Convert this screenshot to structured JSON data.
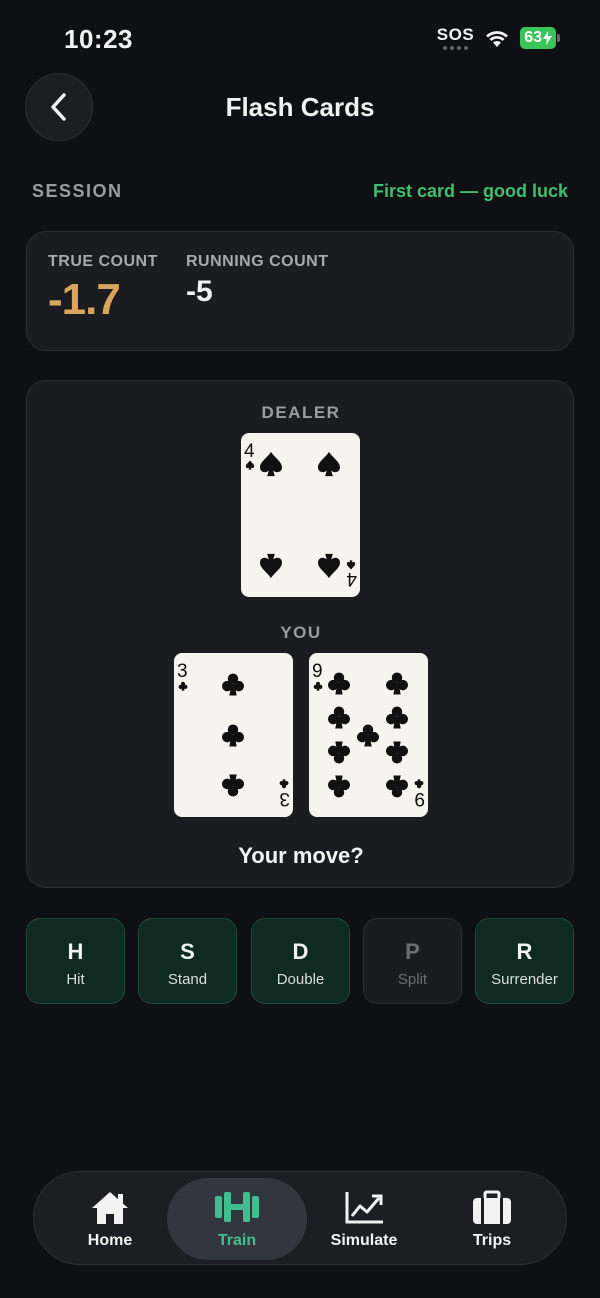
{
  "status_bar": {
    "time": "10:23",
    "sos": "SOS",
    "battery": "63"
  },
  "header": {
    "title": "Flash Cards"
  },
  "session": {
    "label": "SESSION",
    "message": "First card — good luck"
  },
  "counts": {
    "true_count": {
      "label": "TRUE COUNT",
      "value": "-1.7"
    },
    "running_count": {
      "label": "RUNNING COUNT",
      "value": "-5"
    }
  },
  "table": {
    "dealer_label": "DEALER",
    "you_label": "YOU",
    "prompt": "Your move?",
    "dealer_cards": [
      {
        "rank": "4",
        "suit": "spades"
      }
    ],
    "player_cards": [
      {
        "rank": "3",
        "suit": "clubs"
      },
      {
        "rank": "9",
        "suit": "clubs"
      }
    ]
  },
  "actions": [
    {
      "key": "H",
      "label": "Hit",
      "enabled": true
    },
    {
      "key": "S",
      "label": "Stand",
      "enabled": true
    },
    {
      "key": "D",
      "label": "Double",
      "enabled": true
    },
    {
      "key": "P",
      "label": "Split",
      "enabled": false
    },
    {
      "key": "R",
      "label": "Surrender",
      "enabled": true
    }
  ],
  "tabs": [
    {
      "label": "Home",
      "icon": "home-icon",
      "active": false
    },
    {
      "label": "Train",
      "icon": "dumbbell-icon",
      "active": true
    },
    {
      "label": "Simulate",
      "icon": "chart-icon",
      "active": false
    },
    {
      "label": "Trips",
      "icon": "briefcase-icon",
      "active": false
    }
  ],
  "colors": {
    "background": "#0f1013",
    "accent_green": "#3fbf6f",
    "true_count_gold": "#d9a55c",
    "action_bg": "#0f2a21"
  }
}
